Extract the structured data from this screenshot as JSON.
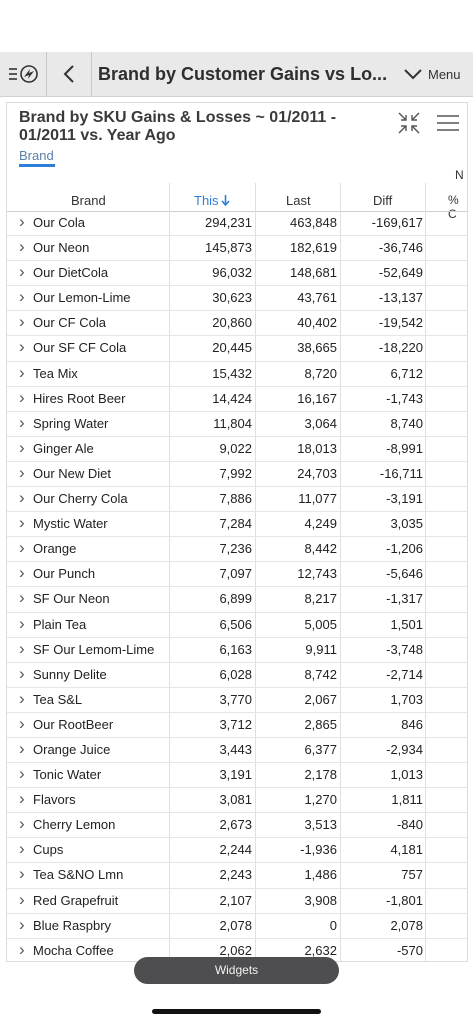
{
  "topbar": {
    "title": "Brand by Customer Gains vs Lo...",
    "menu_label": "Menu"
  },
  "card": {
    "title": "Brand by SKU Gains & Losses ~ 01/2011 - 01/2011 vs. Year Ago",
    "subtitle": "Brand",
    "hint_n": "N",
    "hint_pct": "% C"
  },
  "table": {
    "headers": {
      "brand": "Brand",
      "this": "This",
      "last": "Last",
      "diff": "Diff"
    },
    "sort_color": "#2f7fd6",
    "rows": [
      {
        "brand": "Our Cola",
        "this": "294,231",
        "last": "463,848",
        "diff": "-169,617"
      },
      {
        "brand": "Our Neon",
        "this": "145,873",
        "last": "182,619",
        "diff": "-36,746"
      },
      {
        "brand": "Our DietCola",
        "this": "96,032",
        "last": "148,681",
        "diff": "-52,649"
      },
      {
        "brand": "Our Lemon-Lime",
        "this": "30,623",
        "last": "43,761",
        "diff": "-13,137"
      },
      {
        "brand": "Our CF Cola",
        "this": "20,860",
        "last": "40,402",
        "diff": "-19,542"
      },
      {
        "brand": "Our SF CF Cola",
        "this": "20,445",
        "last": "38,665",
        "diff": "-18,220"
      },
      {
        "brand": "Tea Mix",
        "this": "15,432",
        "last": "8,720",
        "diff": "6,712"
      },
      {
        "brand": "Hires Root Beer",
        "this": "14,424",
        "last": "16,167",
        "diff": "-1,743"
      },
      {
        "brand": "Spring Water",
        "this": "11,804",
        "last": "3,064",
        "diff": "8,740"
      },
      {
        "brand": "Ginger Ale",
        "this": "9,022",
        "last": "18,013",
        "diff": "-8,991"
      },
      {
        "brand": "Our New Diet",
        "this": "7,992",
        "last": "24,703",
        "diff": "-16,711"
      },
      {
        "brand": "Our Cherry Cola",
        "this": "7,886",
        "last": "11,077",
        "diff": "-3,191"
      },
      {
        "brand": "Mystic Water",
        "this": "7,284",
        "last": "4,249",
        "diff": "3,035"
      },
      {
        "brand": "Orange",
        "this": "7,236",
        "last": "8,442",
        "diff": "-1,206"
      },
      {
        "brand": "Our Punch",
        "this": "7,097",
        "last": "12,743",
        "diff": "-5,646"
      },
      {
        "brand": "SF Our Neon",
        "this": "6,899",
        "last": "8,217",
        "diff": "-1,317"
      },
      {
        "brand": "Plain Tea",
        "this": "6,506",
        "last": "5,005",
        "diff": "1,501"
      },
      {
        "brand": "SF Our Lemom-Lime",
        "this": "6,163",
        "last": "9,911",
        "diff": "-3,748"
      },
      {
        "brand": "Sunny Delite",
        "this": "6,028",
        "last": "8,742",
        "diff": "-2,714"
      },
      {
        "brand": "Tea S&L",
        "this": "3,770",
        "last": "2,067",
        "diff": "1,703"
      },
      {
        "brand": "Our RootBeer",
        "this": "3,712",
        "last": "2,865",
        "diff": "846"
      },
      {
        "brand": "Orange Juice",
        "this": "3,443",
        "last": "6,377",
        "diff": "-2,934"
      },
      {
        "brand": "Tonic Water",
        "this": "3,191",
        "last": "2,178",
        "diff": "1,013"
      },
      {
        "brand": "Flavors",
        "this": "3,081",
        "last": "1,270",
        "diff": "1,811"
      },
      {
        "brand": "Cherry Lemon",
        "this": "2,673",
        "last": "3,513",
        "diff": "-840"
      },
      {
        "brand": "Cups",
        "this": "2,244",
        "last": "-1,936",
        "diff": "4,181"
      },
      {
        "brand": "Tea S&NO Lmn",
        "this": "2,243",
        "last": "1,486",
        "diff": "757"
      },
      {
        "brand": "Red Grapefruit",
        "this": "2,107",
        "last": "3,908",
        "diff": "-1,801"
      },
      {
        "brand": "Blue Raspbry",
        "this": "2,078",
        "last": "0",
        "diff": "2,078"
      },
      {
        "brand": "Mocha Coffee",
        "this": "2,062",
        "last": "2,632",
        "diff": "-570"
      }
    ]
  },
  "footer": {
    "widgets_label": "Widgets"
  }
}
